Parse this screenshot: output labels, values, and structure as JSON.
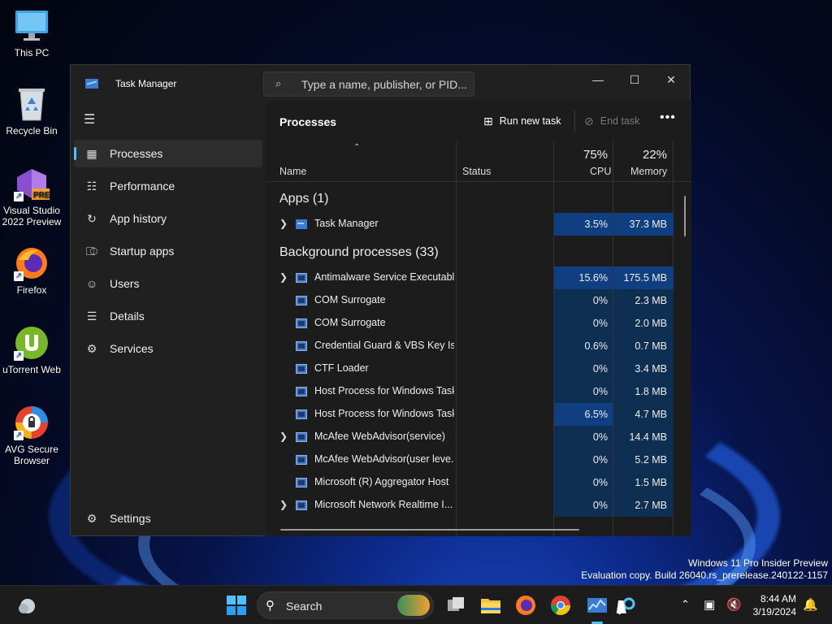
{
  "desktop": {
    "icons": [
      {
        "label": "This PC",
        "icon": "monitor-icon"
      },
      {
        "label": "Recycle Bin",
        "icon": "recycle-bin-icon"
      },
      {
        "label": "Visual Studio 2022 Preview",
        "icon": "visual-studio-icon",
        "badge": "PRE"
      },
      {
        "label": "Firefox",
        "icon": "firefox-icon"
      },
      {
        "label": "uTorrent Web",
        "icon": "utorrent-icon"
      },
      {
        "label": "AVG Secure Browser",
        "icon": "avg-browser-icon"
      }
    ],
    "watermark": {
      "line1": "Windows 11 Pro Insider Preview",
      "line2": "Evaluation copy. Build 26040.rs_prerelease.240122-1157"
    }
  },
  "window": {
    "title": "Task Manager",
    "search_placeholder": "Type a name, publisher, or PID...",
    "controls": {
      "minimize": "—",
      "maximize": "☐",
      "close": "✕"
    }
  },
  "sidebar": {
    "items": [
      {
        "label": "Processes",
        "icon": "processes-icon",
        "active": true
      },
      {
        "label": "Performance",
        "icon": "performance-icon"
      },
      {
        "label": "App history",
        "icon": "history-icon"
      },
      {
        "label": "Startup apps",
        "icon": "startup-icon"
      },
      {
        "label": "Users",
        "icon": "users-icon"
      },
      {
        "label": "Details",
        "icon": "details-icon"
      },
      {
        "label": "Services",
        "icon": "services-icon"
      }
    ],
    "settings": "Settings"
  },
  "toolbar": {
    "title": "Processes",
    "run_new_task": "Run new task",
    "end_task": "End task",
    "more": "•••"
  },
  "columns": {
    "name": "Name",
    "status": "Status",
    "cpu_pct": "75%",
    "cpu": "CPU",
    "mem_pct": "22%",
    "memory": "Memory"
  },
  "groups": {
    "apps": "Apps (1)",
    "background": "Background processes (33)"
  },
  "apps": [
    {
      "name": "Task Manager",
      "cpu": "3.5%",
      "memory": "37.3 MB",
      "expandable": true
    }
  ],
  "background": [
    {
      "name": "Antimalware Service Executable",
      "cpu": "15.6%",
      "memory": "175.5 MB",
      "expandable": true
    },
    {
      "name": "COM Surrogate",
      "cpu": "0%",
      "memory": "2.3 MB"
    },
    {
      "name": "COM Surrogate",
      "cpu": "0%",
      "memory": "2.0 MB"
    },
    {
      "name": "Credential Guard & VBS Key Is...",
      "cpu": "0.6%",
      "memory": "0.7 MB"
    },
    {
      "name": "CTF Loader",
      "cpu": "0%",
      "memory": "3.4 MB"
    },
    {
      "name": "Host Process for Windows Tasks",
      "cpu": "0%",
      "memory": "1.8 MB"
    },
    {
      "name": "Host Process for Windows Tasks",
      "cpu": "6.5%",
      "memory": "4.7 MB"
    },
    {
      "name": "McAfee WebAdvisor(service)",
      "cpu": "0%",
      "memory": "14.4 MB",
      "expandable": true
    },
    {
      "name": "McAfee WebAdvisor(user leve...",
      "cpu": "0%",
      "memory": "5.2 MB"
    },
    {
      "name": "Microsoft (R) Aggregator Host",
      "cpu": "0%",
      "memory": "1.5 MB"
    },
    {
      "name": "Microsoft Network Realtime I...",
      "cpu": "0%",
      "memory": "2.7 MB",
      "expandable": true
    }
  ],
  "taskbar": {
    "search_label": "Search",
    "clock_time": "8:44 AM",
    "clock_date": "3/19/2024",
    "items": [
      "widgets-icon",
      "start-icon",
      "search-icon",
      "task-view-icon",
      "file-explorer-icon",
      "firefox-icon",
      "chrome-icon",
      "task-manager-icon",
      "cortana-icon"
    ]
  }
}
